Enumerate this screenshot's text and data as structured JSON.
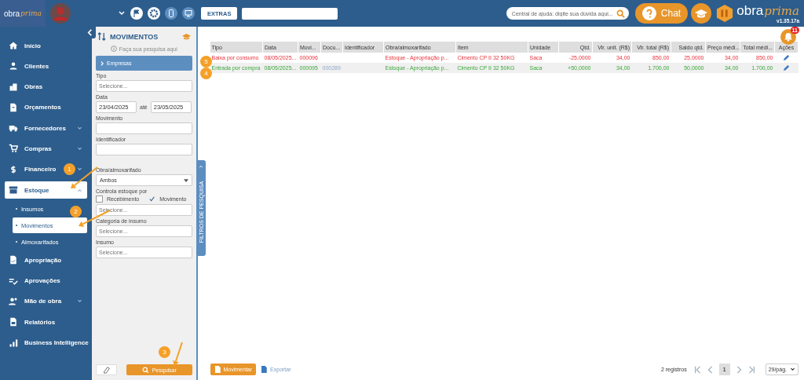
{
  "topbar": {
    "logo": {
      "word": "obra",
      "script": "prima"
    },
    "extras_button": "EXTRAS",
    "help_search": {
      "placeholder": "Central de ajuda: digite sua dúvida aqui..."
    },
    "chat_button": "Chat",
    "brand": {
      "word": "obra",
      "script": "prima",
      "version": "v1.35.17a"
    }
  },
  "sidebar": {
    "items": [
      {
        "label": "Início",
        "kind": "link",
        "selected": false
      },
      {
        "label": "Clientes",
        "kind": "link",
        "selected": false
      },
      {
        "label": "Obras",
        "kind": "link",
        "selected": false
      },
      {
        "label": "Orçamentos",
        "kind": "link",
        "selected": false
      },
      {
        "label": "Fornecedores",
        "kind": "group",
        "expanded": false,
        "selected": false
      },
      {
        "label": "Compras",
        "kind": "group",
        "expanded": false,
        "selected": false
      },
      {
        "label": "Financeiro",
        "kind": "group",
        "expanded": false,
        "selected": false
      },
      {
        "label": "Estoque",
        "kind": "group",
        "expanded": true,
        "selected": true,
        "children": [
          {
            "label": "Insumos",
            "selected": false
          },
          {
            "label": "Movimentos",
            "selected": true
          },
          {
            "label": "Almoxarifados",
            "selected": false
          }
        ]
      },
      {
        "label": "Apropriação",
        "kind": "link",
        "selected": false
      },
      {
        "label": "Aprovações",
        "kind": "link",
        "selected": false
      },
      {
        "label": "Mão de obra",
        "kind": "group",
        "expanded": false,
        "selected": false
      },
      {
        "label": "Relatórios",
        "kind": "link",
        "selected": false
      },
      {
        "label": "Business Intelligence",
        "kind": "link",
        "selected": false
      }
    ]
  },
  "filters": {
    "title": "MOVIMENTOS",
    "hint": "Faça sua pesquisa aqui",
    "companies_button": "Empresas",
    "fields": [
      {
        "kind": "select",
        "label": "Tipo",
        "placeholder": "Selecione..."
      },
      {
        "kind": "daterange",
        "label": "Data",
        "from": "23/04/2025",
        "separator": "até",
        "to": "23/05/2025"
      },
      {
        "kind": "text",
        "label": "Movimento"
      },
      {
        "kind": "text",
        "label": "Identificador"
      },
      {
        "kind": "dropdown",
        "label": "Obra/almoxarifado",
        "value": "Ambos"
      },
      {
        "kind": "checks",
        "label": "Controla estoque por",
        "options": [
          {
            "label": "Recebimento",
            "checked": false
          },
          {
            "label": "Movimento",
            "checked": true
          }
        ],
        "placeholder": "Selecione..."
      },
      {
        "kind": "select",
        "label": "Categoria de insumo",
        "placeholder": "Selecione..."
      },
      {
        "kind": "select",
        "label": "Insumo",
        "placeholder": "Selecione..."
      }
    ],
    "search_button": "Pesquisar",
    "side_tab": "FILTROS DE PESQUISA"
  },
  "table": {
    "columns": [
      "Tipo",
      "Data",
      "Movi...",
      "Docu...",
      "Identificador",
      "Obra/almoxarifado",
      "Item",
      "Unidade",
      "Qtd.",
      "Vlr. unit. (R$)",
      "Vlr. total (R$)",
      "Saldo qtd.",
      "Preço médi...",
      "Total médi...",
      "Ações"
    ],
    "rows": [
      {
        "kind": "outgoing",
        "cells": [
          "Baixa por consumo",
          "08/05/2025...",
          "000096",
          "",
          "",
          "Estoque - Apropriação p...",
          "Cimento CP II 32 50KG",
          "Saca",
          "-25,0000",
          "34,00",
          "850,00",
          "25,0000",
          "34,00",
          "850,00"
        ]
      },
      {
        "kind": "incoming",
        "cells": [
          "Entrada por compra",
          "08/05/2025...",
          "000095",
          "000289",
          "",
          "Estoque - Apropriação p...",
          "Cimento CP II 32 50KG",
          "Saca",
          "+50,0000",
          "34,00",
          "1.700,00",
          "50,0000",
          "34,00",
          "1.700,00"
        ]
      }
    ]
  },
  "notification_count": "11",
  "footer": {
    "add_button": "Movimentar",
    "export_link": "Exportar",
    "count": "2 registros",
    "page": "1",
    "page_size": "29/pág."
  },
  "annotations": [
    {
      "label": "1"
    },
    {
      "label": "2"
    },
    {
      "label": "3"
    },
    {
      "label": "5"
    },
    {
      "label": "4"
    }
  ]
}
